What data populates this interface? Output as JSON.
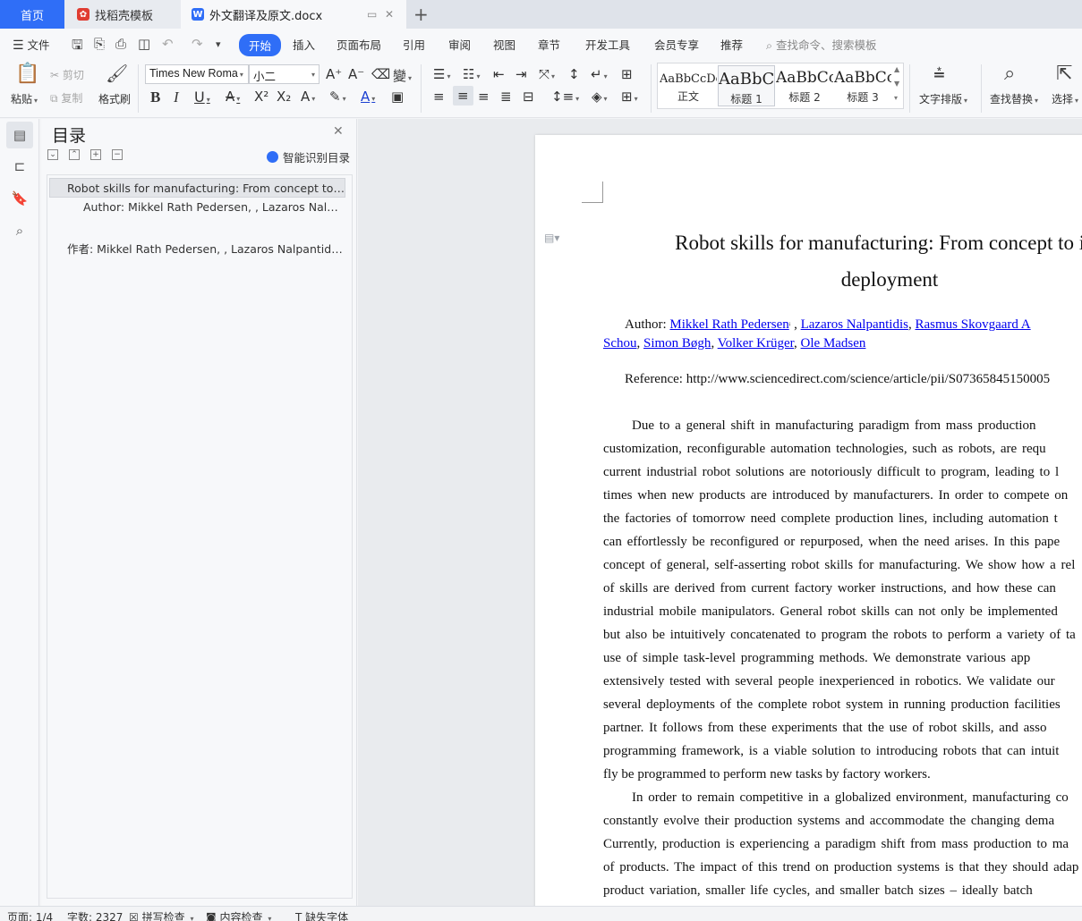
{
  "tabs": {
    "home": "首页",
    "template": "找稻壳模板",
    "document": "外文翻译及原文.docx"
  },
  "menu": {
    "file": "文件",
    "items": [
      "开始",
      "插入",
      "页面布局",
      "引用",
      "审阅",
      "视图",
      "章节",
      "开发工具",
      "会员专享",
      "推荐"
    ],
    "search_placeholder": "查找命令、搜索模板"
  },
  "ribbon": {
    "paste": "粘贴",
    "cut": "剪切",
    "copy": "复制",
    "format_painter": "格式刷",
    "font_name": "Times New Roma",
    "font_size": "小二",
    "styles": [
      {
        "sample": "AaBbCcDd",
        "name": "正文"
      },
      {
        "sample": "AaBbCc",
        "name": "标题 1"
      },
      {
        "sample": "AaBbCc",
        "name": "标题 2"
      },
      {
        "sample": "AaBbCcI",
        "name": "标题 3"
      }
    ],
    "text_layout": "文字排版",
    "find_replace": "查找替换",
    "select": "选择"
  },
  "toc": {
    "title": "目录",
    "smart_recognize": "智能识别目录",
    "items": [
      "Robot skills for manufacturing: From concept to in ...",
      "Author: Mikkel Rath Pedersen, , Lazaros Nalpan ...",
      "作者: Mikkel Rath Pedersen, , Lazaros Nalpantidis, ..."
    ]
  },
  "document": {
    "title_line1": "Robot skills for manufacturing: From concept to inc",
    "title_line2": "deployment",
    "author_label": "Author:",
    "authors_line1": [
      "Mikkel Rath Pedersen",
      "Lazaros Nalpantidis",
      "Rasmus Skovgaard A"
    ],
    "authors_line2": [
      "Schou",
      "Simon Bøgh",
      "Volker Krüger",
      "Ole Madsen"
    ],
    "reference": "Reference: http://www.sciencedirect.com/science/article/pii/S07365845150005",
    "body_lines": [
      "Due to a general shift in manufacturing paradigm from mass production",
      "customization, reconfigurable automation technologies, such as robots, are requ",
      "current industrial robot solutions are notoriously difficult to program, leading to l",
      "times when new products are introduced by manufacturers. In order to compete on",
      "the factories of tomorrow need complete production lines, including automation t",
      "can effortlessly be reconfigured or repurposed, when the need arises. In this pape",
      "concept of general, self-asserting robot skills for manufacturing. We show how a rel",
      "of skills are derived from current factory worker instructions, and how these can",
      "industrial mobile manipulators. General robot skills can not only be implemented",
      "but also be intuitively concatenated to program the robots to perform a variety of ta",
      "use of simple task-level programming methods. We demonstrate various app",
      "extensively tested with several people inexperienced in robotics. We validate our",
      "several deployments of the complete robot system in running production facilities",
      "partner. It follows from these experiments that the use of robot skills, and asso",
      "programming framework, is a viable solution to introducing robots that can intuit",
      "fly be programmed to perform new tasks by factory workers.",
      "In order to remain competitive in a globalized environment, manufacturing co",
      "constantly evolve their production systems and accommodate the changing dema",
      "Currently, production is experiencing a paradigm shift from mass production to ma",
      "of products. The impact of this trend on production systems is that they should adap",
      "product variation, smaller life cycles, and smaller batch sizes – ideally batch"
    ]
  },
  "status": {
    "page": "页面: 1/4",
    "word_count": "字数: 2327",
    "spell_check": "拼写检查",
    "content_check": "内容检查",
    "missing_font": "缺失字体"
  }
}
